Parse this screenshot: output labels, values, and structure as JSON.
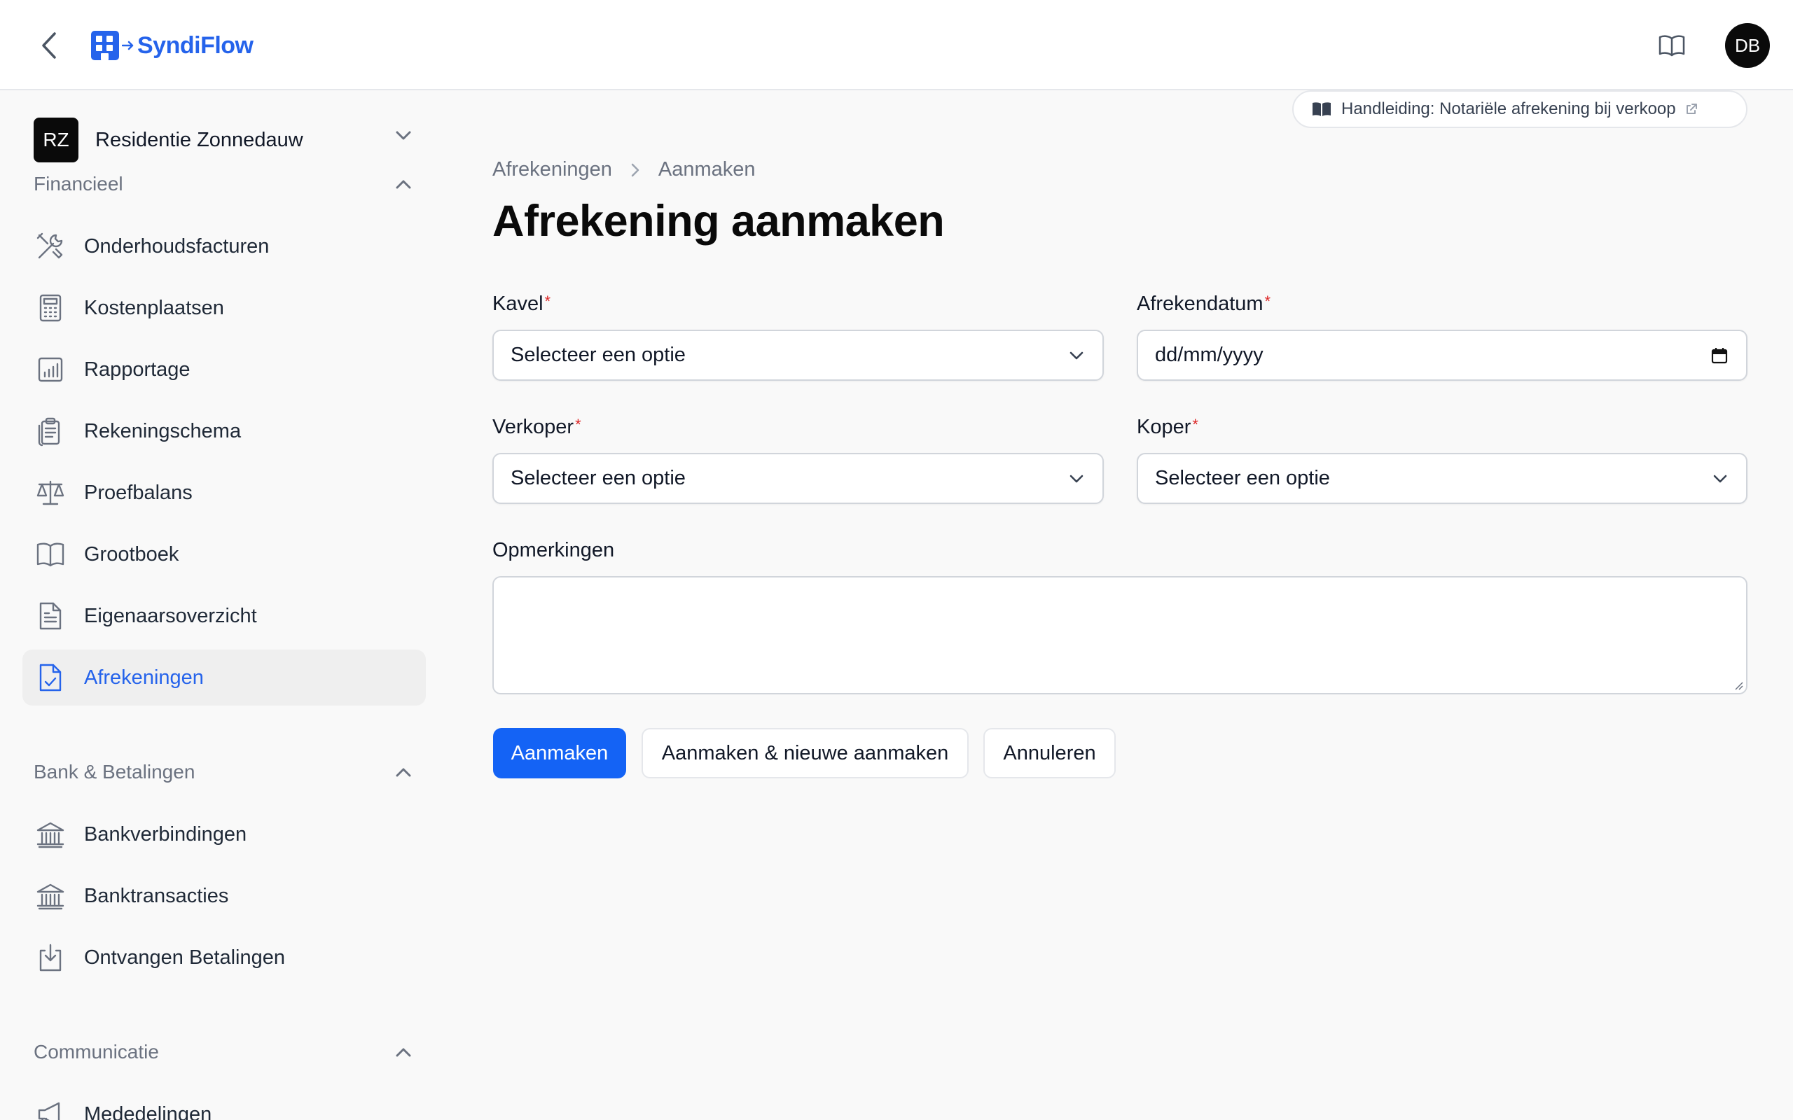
{
  "app": {
    "brand": "SyndiFlow",
    "user_initials": "DB"
  },
  "tenant": {
    "initials": "RZ",
    "name": "Residentie Zonnedauw"
  },
  "sidebar": {
    "groups": [
      {
        "label": "Financieel",
        "items": [
          {
            "label": "Onderhoudsfacturen",
            "icon": "tools-icon"
          },
          {
            "label": "Kostenplaatsen",
            "icon": "calculator-icon"
          },
          {
            "label": "Rapportage",
            "icon": "chart-icon"
          },
          {
            "label": "Rekeningschema",
            "icon": "clipboard-icon"
          },
          {
            "label": "Proefbalans",
            "icon": "scale-icon"
          },
          {
            "label": "Grootboek",
            "icon": "book-open-icon"
          },
          {
            "label": "Eigenaarsoverzicht",
            "icon": "document-icon"
          },
          {
            "label": "Afrekeningen",
            "icon": "document-check-icon",
            "active": true
          }
        ]
      },
      {
        "label": "Bank & Betalingen",
        "items": [
          {
            "label": "Bankverbindingen",
            "icon": "bank-icon"
          },
          {
            "label": "Banktransacties",
            "icon": "bank-icon"
          },
          {
            "label": "Ontvangen Betalingen",
            "icon": "download-icon"
          }
        ]
      },
      {
        "label": "Communicatie",
        "items": [
          {
            "label": "Mededelingen",
            "icon": "megaphone-icon"
          }
        ]
      }
    ]
  },
  "guide": {
    "label": "Handleiding: Notariële afrekening bij verkoop"
  },
  "breadcrumb": {
    "parent": "Afrekeningen",
    "current": "Aanmaken"
  },
  "page": {
    "title": "Afrekening aanmaken"
  },
  "form": {
    "kavel": {
      "label": "Kavel",
      "required": "*",
      "value": "Selecteer een optie"
    },
    "afrekendatum": {
      "label": "Afrekendatum",
      "required": "*",
      "value": "dd/mm/yyyy"
    },
    "verkoper": {
      "label": "Verkoper",
      "required": "*",
      "value": "Selecteer een optie"
    },
    "koper": {
      "label": "Koper",
      "required": "*",
      "value": "Selecteer een optie"
    },
    "opmerkingen": {
      "label": "Opmerkingen",
      "value": ""
    }
  },
  "actions": {
    "create": "Aanmaken",
    "create_another": "Aanmaken & nieuwe aanmaken",
    "cancel": "Annuleren"
  },
  "colors": {
    "accent": "#1463f5",
    "brand": "#2563eb",
    "required": "#dc2626"
  }
}
